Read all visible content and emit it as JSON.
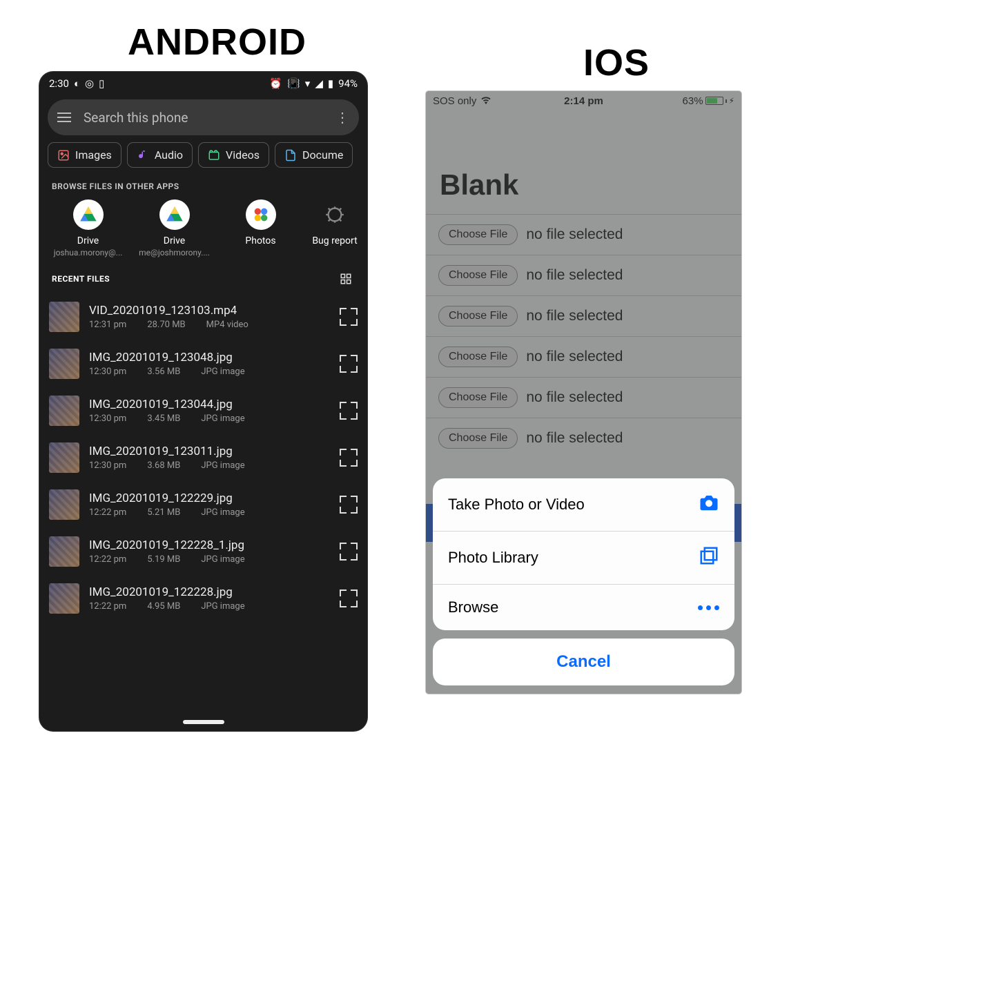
{
  "headings": {
    "android": "ANDROID",
    "ios": "IOS"
  },
  "android": {
    "status": {
      "time": "2:30",
      "battery": "94%"
    },
    "search": {
      "placeholder": "Search this phone"
    },
    "chips": [
      {
        "label": "Images",
        "color": "#e36a6a"
      },
      {
        "label": "Audio",
        "color": "#a36af0"
      },
      {
        "label": "Videos",
        "color": "#4fd08a"
      },
      {
        "label": "Docume",
        "color": "#5bb6f0"
      }
    ],
    "browse_label": "BROWSE FILES IN OTHER APPS",
    "apps": [
      {
        "name": "Drive",
        "sub": "joshua.morony@..."
      },
      {
        "name": "Drive",
        "sub": "me@joshmorony...."
      },
      {
        "name": "Photos",
        "sub": ""
      },
      {
        "name": "Bug report",
        "sub": ""
      }
    ],
    "recent_label": "RECENT FILES",
    "files": [
      {
        "name": "VID_20201019_123103.mp4",
        "time": "12:31 pm",
        "size": "28.70 MB",
        "type": "MP4 video"
      },
      {
        "name": "IMG_20201019_123048.jpg",
        "time": "12:30 pm",
        "size": "3.56 MB",
        "type": "JPG image"
      },
      {
        "name": "IMG_20201019_123044.jpg",
        "time": "12:30 pm",
        "size": "3.45 MB",
        "type": "JPG image"
      },
      {
        "name": "IMG_20201019_123011.jpg",
        "time": "12:30 pm",
        "size": "3.68 MB",
        "type": "JPG image"
      },
      {
        "name": "IMG_20201019_122229.jpg",
        "time": "12:22 pm",
        "size": "5.21 MB",
        "type": "JPG image"
      },
      {
        "name": "IMG_20201019_122228_1.jpg",
        "time": "12:22 pm",
        "size": "5.19 MB",
        "type": "JPG image"
      },
      {
        "name": "IMG_20201019_122228.jpg",
        "time": "12:22 pm",
        "size": "4.95 MB",
        "type": "JPG image"
      }
    ]
  },
  "ios": {
    "status": {
      "carrier": "SOS only",
      "time": "2:14 pm",
      "battery": "63%"
    },
    "title": "Blank",
    "choose_label": "Choose File",
    "nofile_label": "no file selected",
    "row_count": 6,
    "sheet": {
      "items": [
        {
          "label": "Take Photo or Video",
          "icon": "camera"
        },
        {
          "label": "Photo Library",
          "icon": "library"
        },
        {
          "label": "Browse",
          "icon": "ellipsis"
        }
      ],
      "cancel": "Cancel"
    }
  }
}
